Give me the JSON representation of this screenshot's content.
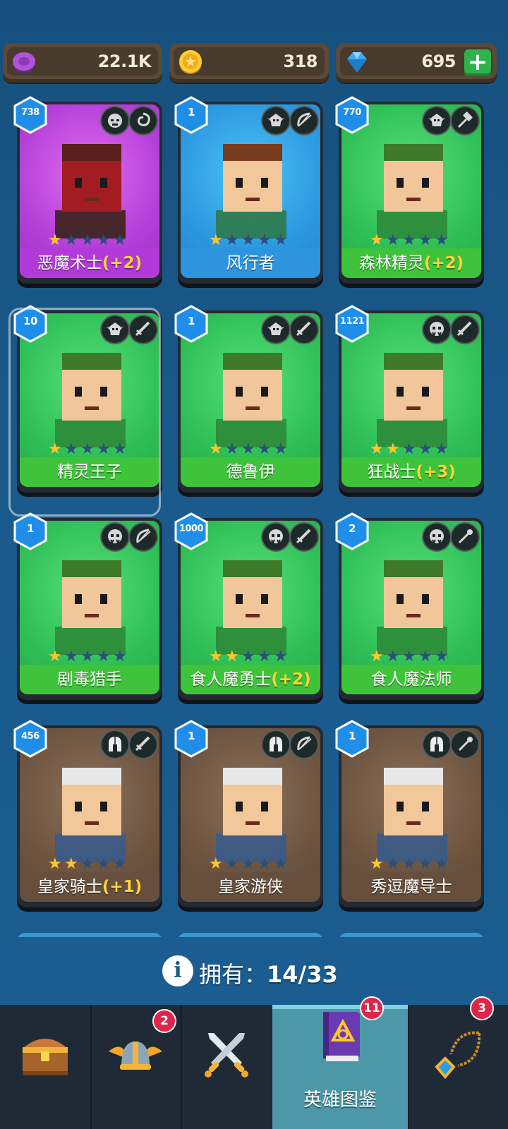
{
  "resources": [
    {
      "icon": "purple-gem-icon",
      "value": "22.1K"
    },
    {
      "icon": "gold-coin-icon",
      "value": "318"
    },
    {
      "icon": "blue-diamond-icon",
      "value": "695",
      "add_label": "+"
    }
  ],
  "heroes": [
    {
      "name": "恶魔术士",
      "bonus": "(+2)",
      "level": "738",
      "stars": 1,
      "bg": "purple",
      "faction": "demon-mask-icon",
      "weapon": "magic-swirl-icon"
    },
    {
      "name": "风行者",
      "bonus": "",
      "level": "1",
      "stars": 1,
      "bg": "blue",
      "faction": "elf-icon",
      "weapon": "bow-icon"
    },
    {
      "name": "森林精灵",
      "bonus": "(+2)",
      "level": "770",
      "stars": 1,
      "bg": "green",
      "faction": "elf-icon",
      "weapon": "hammer-icon"
    },
    {
      "name": "精灵王子",
      "bonus": "",
      "level": "10",
      "stars": 1,
      "bg": "green",
      "faction": "elf-icon",
      "weapon": "sword-icon"
    },
    {
      "name": "德鲁伊",
      "bonus": "",
      "level": "1",
      "stars": 1,
      "bg": "green",
      "faction": "elf-icon",
      "weapon": "sword-icon"
    },
    {
      "name": "狂战士",
      "bonus": "(+3)",
      "level": "1121",
      "stars": 2,
      "bg": "green",
      "faction": "orc-icon",
      "weapon": "sword-icon"
    },
    {
      "name": "剧毒猎手",
      "bonus": "",
      "level": "1",
      "stars": 1,
      "bg": "green",
      "faction": "orc-icon",
      "weapon": "bow-icon"
    },
    {
      "name": "食人魔勇士",
      "bonus": "(+2)",
      "level": "1000",
      "stars": 2,
      "bg": "green",
      "faction": "orc-icon",
      "weapon": "sword-icon"
    },
    {
      "name": "食人魔法师",
      "bonus": "",
      "level": "2",
      "stars": 1,
      "bg": "green",
      "faction": "orc-icon",
      "weapon": "staff-icon"
    },
    {
      "name": "皇家骑士",
      "bonus": "(+1)",
      "level": "456",
      "stars": 2,
      "bg": "brown",
      "faction": "helmet-icon",
      "weapon": "sword-icon"
    },
    {
      "name": "皇家游侠",
      "bonus": "",
      "level": "1",
      "stars": 1,
      "bg": "brown",
      "faction": "helmet-icon",
      "weapon": "bow-icon"
    },
    {
      "name": "秀逗魔导士",
      "bonus": "",
      "level": "1",
      "stars": 1,
      "bg": "brown",
      "faction": "helmet-icon",
      "weapon": "staff-icon"
    }
  ],
  "owned": {
    "label": "拥有：",
    "count": "14/33"
  },
  "nav": [
    {
      "icon": "treasure-chest-icon",
      "label": "",
      "badge": ""
    },
    {
      "icon": "winged-helmet-icon",
      "label": "",
      "badge": "2"
    },
    {
      "icon": "crossed-swords-icon",
      "label": "",
      "badge": ""
    },
    {
      "icon": "hero-book-icon",
      "label": "英雄图鉴",
      "badge": "11",
      "active": true
    },
    {
      "icon": "amulet-icon",
      "label": "",
      "badge": "3"
    }
  ],
  "colors": {
    "accent_green": "#2eb24a",
    "active_tab": "#4c98a8",
    "bonus": "#ffd23a",
    "star": "#ffc52e"
  }
}
